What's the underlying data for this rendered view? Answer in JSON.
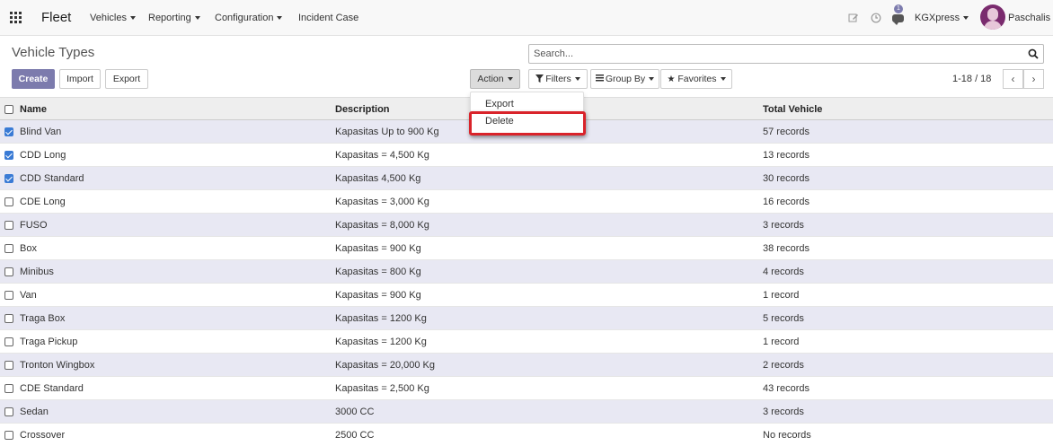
{
  "navbar": {
    "brand": "Fleet",
    "menus": [
      "Vehicles",
      "Reporting",
      "Configuration",
      "Incident Case"
    ],
    "message_count": "1",
    "company": "KGXpress",
    "user": "Paschalis",
    "icons": [
      "apps-grid-icon",
      "edit-icon",
      "clock-icon",
      "chat-icon",
      "user-avatar"
    ]
  },
  "control_panel": {
    "title": "Vehicle Types",
    "search_placeholder": "Search...",
    "create_label": "Create",
    "import_label": "Import",
    "export_label": "Export",
    "action_label": "Action",
    "filters_label": "Filters",
    "group_by_label": "Group By",
    "favorites_label": "Favorites",
    "pager": "1-18 / 18"
  },
  "action_menu": {
    "items": [
      "Export",
      "Delete"
    ],
    "highlighted": "Delete"
  },
  "table": {
    "columns": [
      "Name",
      "Description",
      "Total Vehicle"
    ],
    "rows": [
      {
        "name": "Blind Van",
        "description": "Kapasitas Up to 900 Kg",
        "total": "57 records",
        "selected": true
      },
      {
        "name": "CDD Long",
        "description": "Kapasitas = 4,500 Kg",
        "total": "13 records",
        "selected": true
      },
      {
        "name": "CDD Standard",
        "description": "Kapasitas 4,500 Kg",
        "total": "30 records",
        "selected": true
      },
      {
        "name": "CDE Long",
        "description": "Kapasitas = 3,000 Kg",
        "total": "16 records",
        "selected": false
      },
      {
        "name": "FUSO",
        "description": "Kapasitas = 8,000 Kg",
        "total": "3 records",
        "selected": false
      },
      {
        "name": "Box",
        "description": "Kapasitas = 900 Kg",
        "total": "38 records",
        "selected": false
      },
      {
        "name": "Minibus",
        "description": "Kapasitas = 800 Kg",
        "total": "4 records",
        "selected": false
      },
      {
        "name": "Van",
        "description": "Kapasitas = 900 Kg",
        "total": "1 record",
        "selected": false
      },
      {
        "name": "Traga Box",
        "description": "Kapasitas = 1200 Kg",
        "total": "5 records",
        "selected": false
      },
      {
        "name": "Traga Pickup",
        "description": "Kapasitas = 1200 Kg",
        "total": "1 record",
        "selected": false
      },
      {
        "name": "Tronton Wingbox",
        "description": "Kapasitas = 20,000 Kg",
        "total": "2 records",
        "selected": false
      },
      {
        "name": "CDE Standard",
        "description": "Kapasitas = 2,500 Kg",
        "total": "43 records",
        "selected": false
      },
      {
        "name": "Sedan",
        "description": "3000 CC",
        "total": "3 records",
        "selected": false
      },
      {
        "name": "Crossover",
        "description": "2500 CC",
        "total": "No records",
        "selected": false
      }
    ]
  },
  "colors": {
    "primary": "#7c7bad",
    "highlight_border": "#d9232a",
    "selected_row": "#e8e8f3",
    "checkbox_checked": "#3a7bd5"
  }
}
